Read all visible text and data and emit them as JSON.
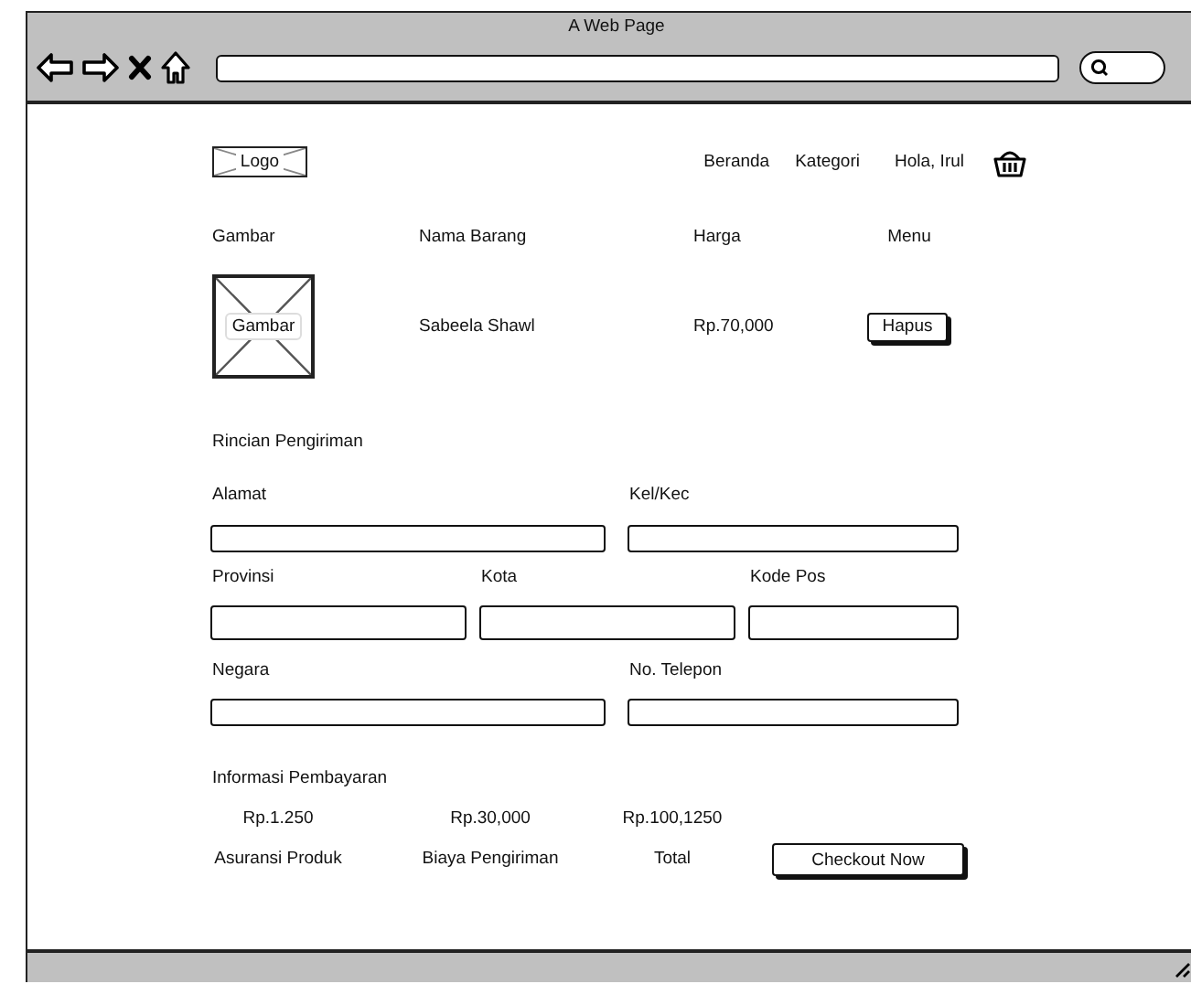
{
  "window": {
    "title": "A Web Page"
  },
  "header": {
    "logo": "Logo",
    "nav": [
      "Beranda",
      "Kategori",
      "Hola, Irul"
    ]
  },
  "cart": {
    "columns": [
      "Gambar",
      "Nama Barang",
      "Harga",
      "Menu"
    ],
    "rows": [
      {
        "image": "Gambar",
        "name": "Sabeela Shawl",
        "price": "Rp.70,000",
        "action": "Hapus"
      }
    ]
  },
  "shipping": {
    "title": "Rincian Pengiriman",
    "rows": [
      {
        "fields": [
          {
            "label": "Alamat"
          },
          {
            "label": "Kel/Kec"
          }
        ]
      },
      {
        "fields": [
          {
            "label": "Provinsi"
          },
          {
            "label": "Kota"
          },
          {
            "label": "Kode Pos"
          }
        ]
      },
      {
        "fields": [
          {
            "label": "Negara"
          },
          {
            "label": "No. Telepon"
          }
        ]
      }
    ]
  },
  "payment": {
    "title": "Informasi Pembayaran",
    "items": [
      {
        "value": "Rp.1.250",
        "label": "Asuransi Produk"
      },
      {
        "value": "Rp.30,000",
        "label": "Biaya Pengiriman"
      },
      {
        "value": "Rp.100,1250",
        "label": "Total"
      }
    ],
    "button": "Checkout Now"
  }
}
